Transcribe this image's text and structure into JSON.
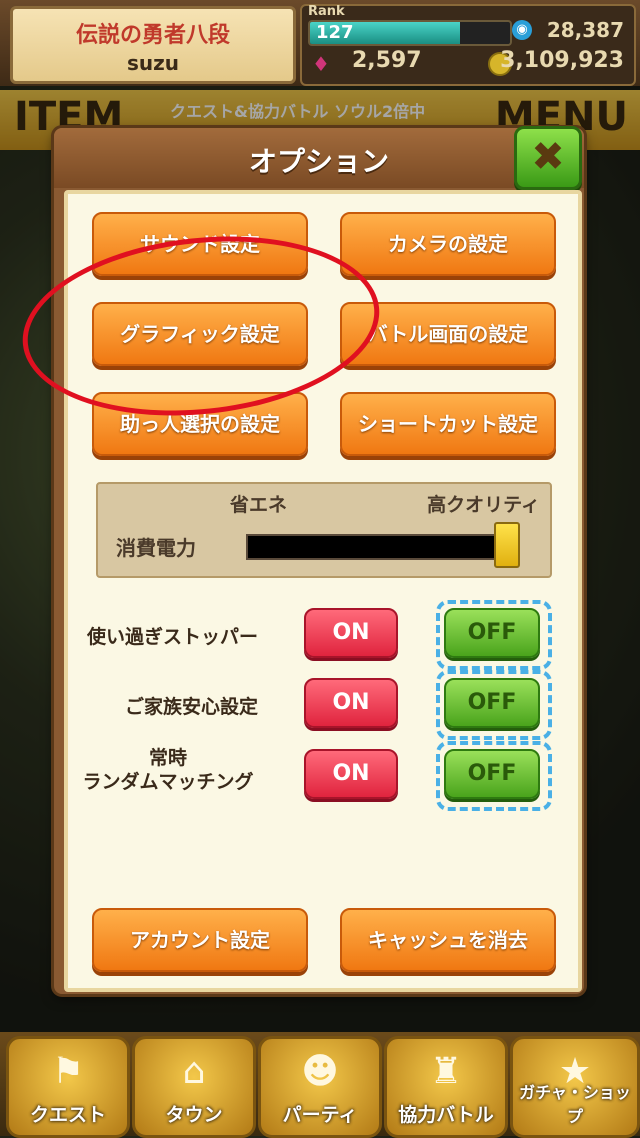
{
  "status": {
    "title": "伝説の勇者八段",
    "user": "suzu",
    "rank_label": "Rank",
    "rank": "127",
    "rank_progress": 0.75,
    "exp": "28,387",
    "gems": "2,597",
    "coins": "3,109,923"
  },
  "background": {
    "item_label": "ITEM",
    "banner_text": "クエスト&協力バトル ソウル2倍中",
    "menu_label": "MENU"
  },
  "dialog": {
    "title": "オプション",
    "close_icon": "close-x-icon",
    "buttons": {
      "sound": "サウンド設定",
      "camera": "カメラの設定",
      "graphics": "グラフィック設定",
      "battle_screen": "バトル画面の設定",
      "helper": "助っ人選択の設定",
      "shortcut": "ショートカット設定",
      "account": "アカウント設定",
      "cache": "キャッシュを消去"
    },
    "power": {
      "eco_label": "省エネ",
      "hq_label": "高クオリティ",
      "label": "消費電力",
      "level": 1.0
    },
    "toggles": [
      {
        "label": "使い過ぎストッパー",
        "on": "ON",
        "off": "OFF",
        "selected": "OFF"
      },
      {
        "label": "ご家族安心設定",
        "on": "ON",
        "off": "OFF",
        "selected": "OFF"
      },
      {
        "label": "常時\nランダムマッチング",
        "on": "ON",
        "off": "OFF",
        "selected": "OFF"
      }
    ]
  },
  "nav": {
    "quest": "クエスト",
    "town": "タウン",
    "party": "パーティ",
    "coop": "協力バトル",
    "gacha": "ガチャ・ショップ"
  },
  "colors": {
    "annotation": "#e01020",
    "accent_orange": "#f07812",
    "on_red": "#e0243e",
    "off_green": "#4aa41c"
  }
}
